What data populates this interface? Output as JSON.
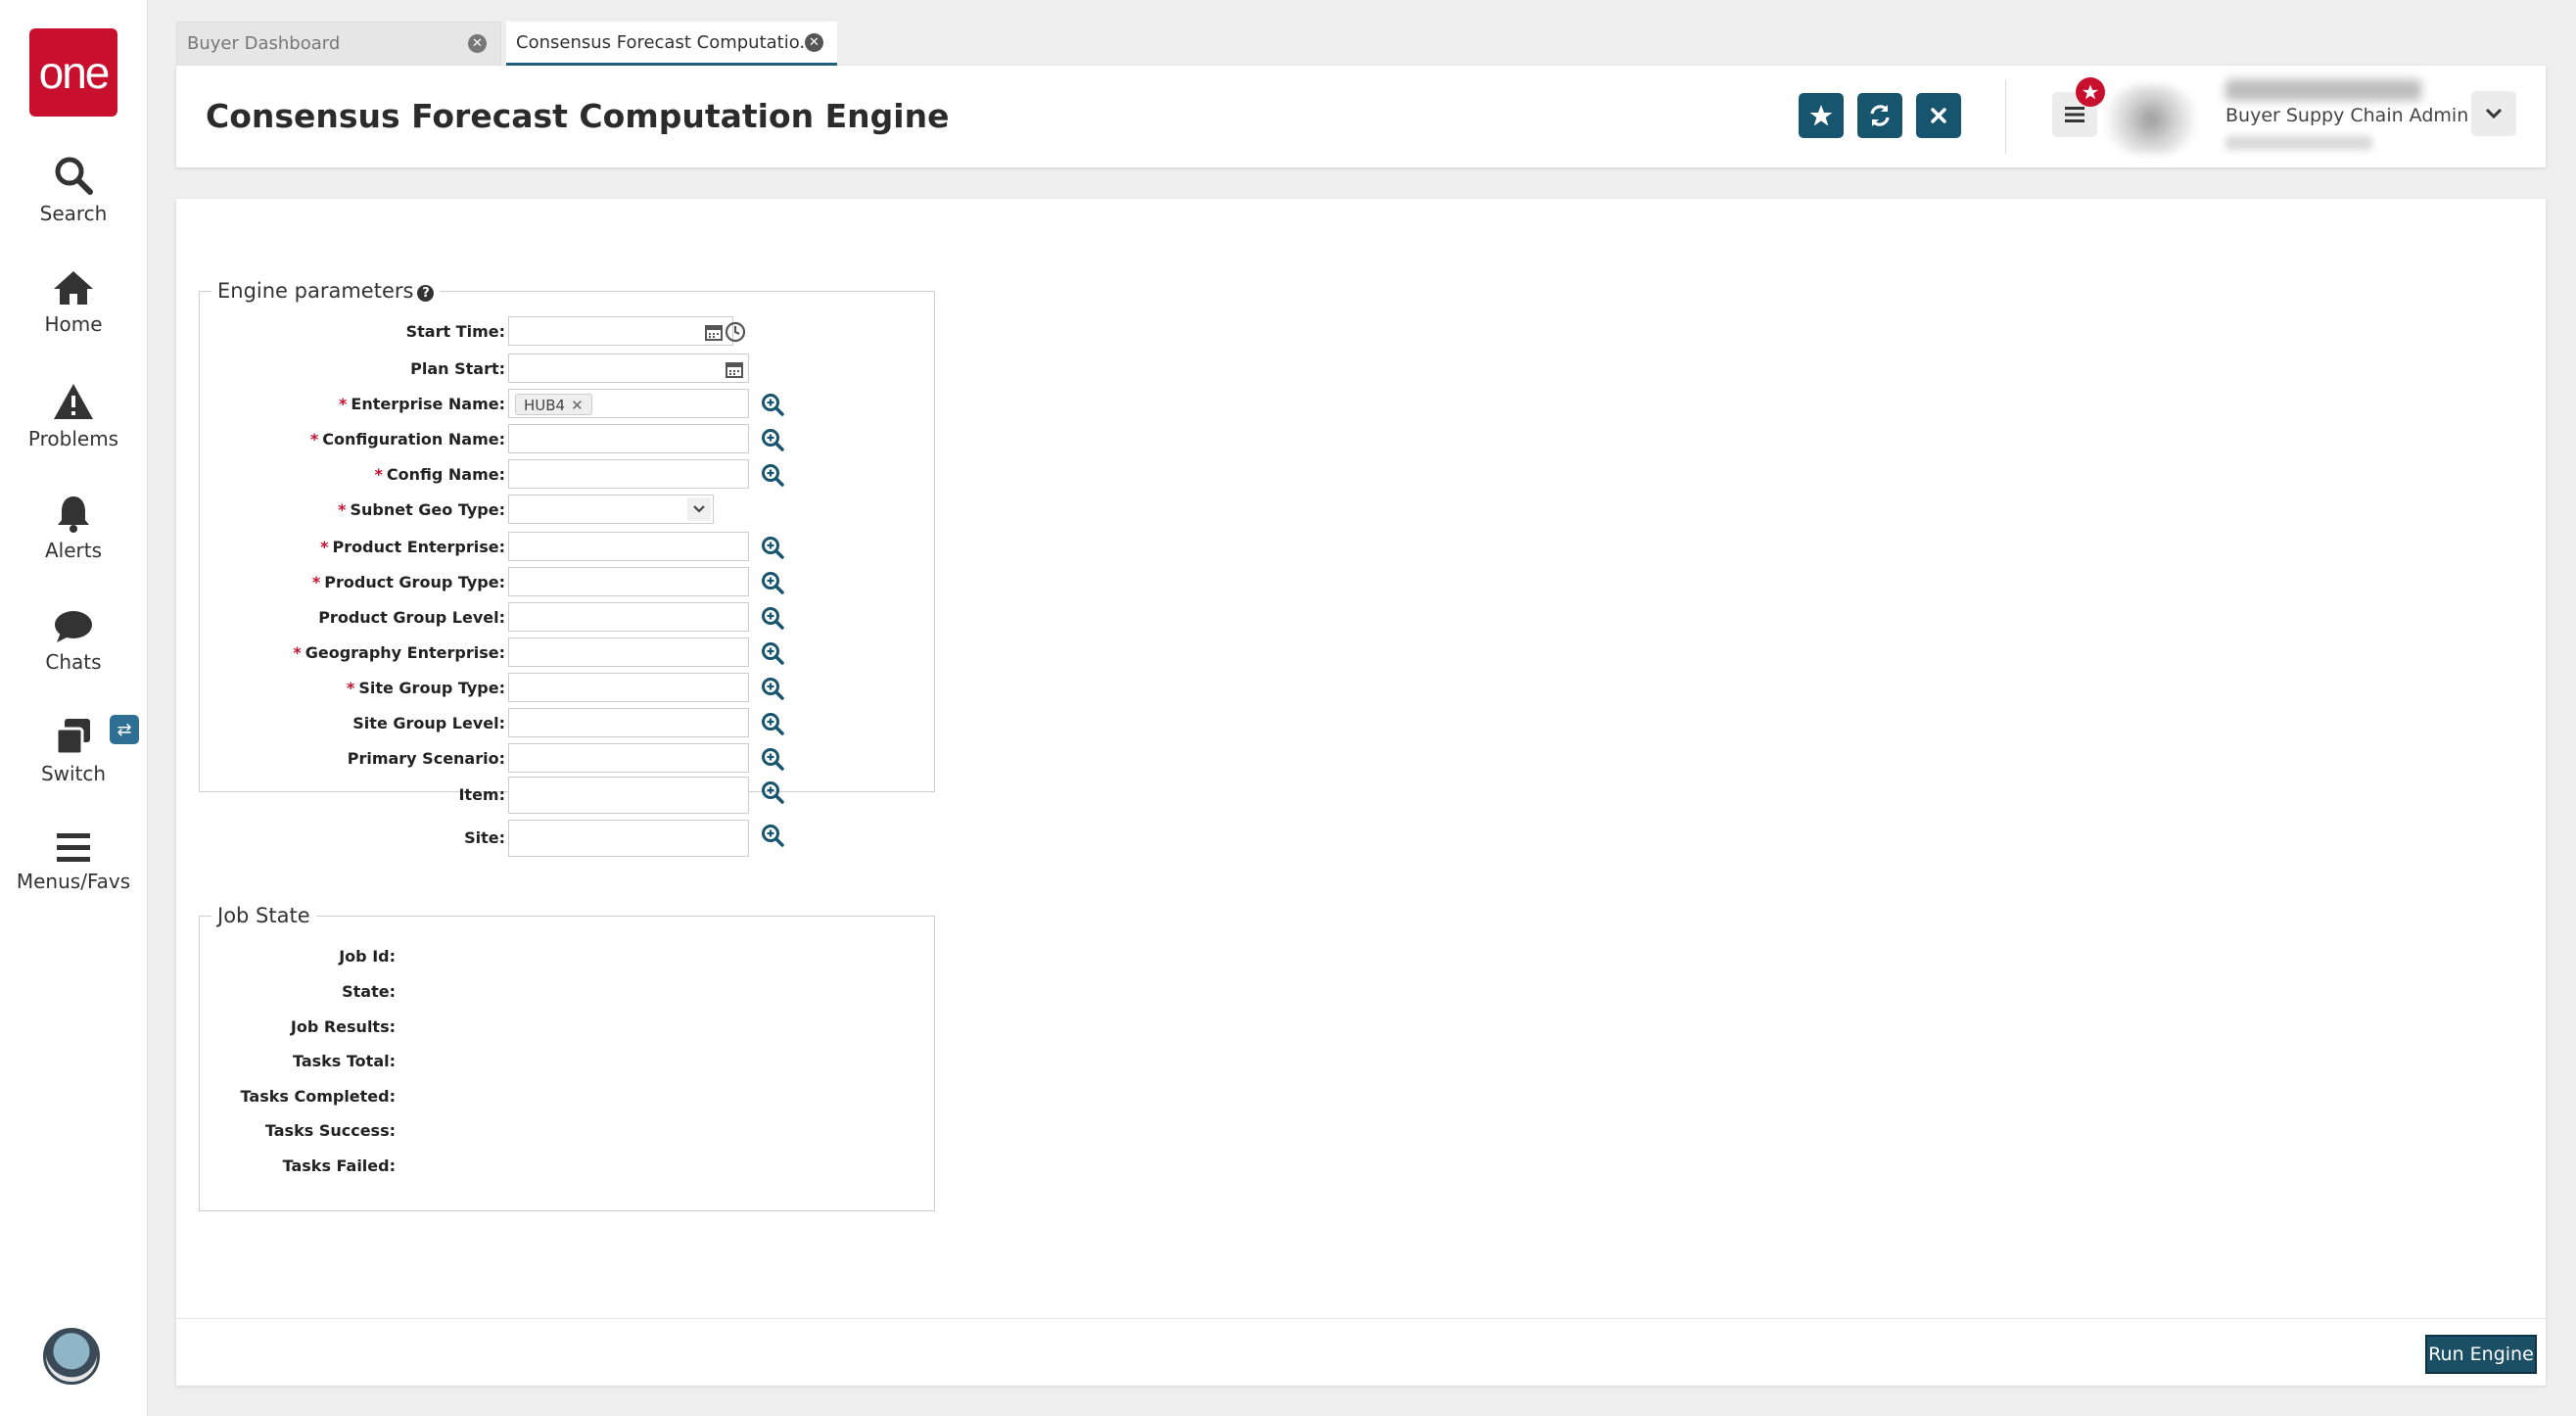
{
  "app": {
    "logo_text": "one",
    "nav": [
      {
        "label": "Search",
        "icon": "search-icon"
      },
      {
        "label": "Home",
        "icon": "home-icon"
      },
      {
        "label": "Problems",
        "icon": "warning-icon"
      },
      {
        "label": "Alerts",
        "icon": "bell-icon"
      },
      {
        "label": "Chats",
        "icon": "chat-icon"
      },
      {
        "label": "Switch",
        "icon": "switch-icon"
      },
      {
        "label": "Menus/Favs",
        "icon": "hamburger-icon"
      }
    ],
    "accent_color": "#17546e",
    "brand_color": "#c8102e"
  },
  "tabs": [
    {
      "label": "Buyer Dashboard",
      "active": false
    },
    {
      "label": "Consensus Forecast Computatio...",
      "active": true
    }
  ],
  "header": {
    "title": "Consensus Forecast Computation Engine",
    "user_role": "Buyer Suppy Chain Admin"
  },
  "engine_params": {
    "legend": "Engine parameters",
    "fields": {
      "start_time": {
        "label": "Start Time:",
        "required": false,
        "value": ""
      },
      "plan_start": {
        "label": "Plan Start:",
        "required": false,
        "value": ""
      },
      "enterprise_name": {
        "label": "Enterprise Name:",
        "required": true,
        "chip": "HUB4"
      },
      "configuration_name": {
        "label": "Configuration Name:",
        "required": true,
        "value": ""
      },
      "config_name": {
        "label": "Config Name:",
        "required": true,
        "value": ""
      },
      "subnet_geo_type": {
        "label": "Subnet Geo Type:",
        "required": true,
        "value": ""
      },
      "product_enterprise": {
        "label": "Product Enterprise:",
        "required": true,
        "value": ""
      },
      "product_group_type": {
        "label": "Product Group Type:",
        "required": true,
        "value": ""
      },
      "product_group_level": {
        "label": "Product Group Level:",
        "required": false,
        "value": ""
      },
      "geography_enterprise": {
        "label": "Geography Enterprise:",
        "required": true,
        "value": ""
      },
      "site_group_type": {
        "label": "Site Group Type:",
        "required": true,
        "value": ""
      },
      "site_group_level": {
        "label": "Site Group Level:",
        "required": false,
        "value": ""
      },
      "primary_scenario": {
        "label": "Primary Scenario:",
        "required": false,
        "value": ""
      },
      "item": {
        "label": "Item:",
        "required": false,
        "value": ""
      },
      "site": {
        "label": "Site:",
        "required": false,
        "value": ""
      }
    }
  },
  "job_state": {
    "legend": "Job State",
    "labels": {
      "job_id": "Job Id:",
      "state": "State:",
      "job_results": "Job Results:",
      "tasks_total": "Tasks Total:",
      "tasks_completed": "Tasks Completed:",
      "tasks_success": "Tasks Success:",
      "tasks_failed": "Tasks Failed:"
    }
  },
  "footer": {
    "run_label": "Run Engine"
  }
}
